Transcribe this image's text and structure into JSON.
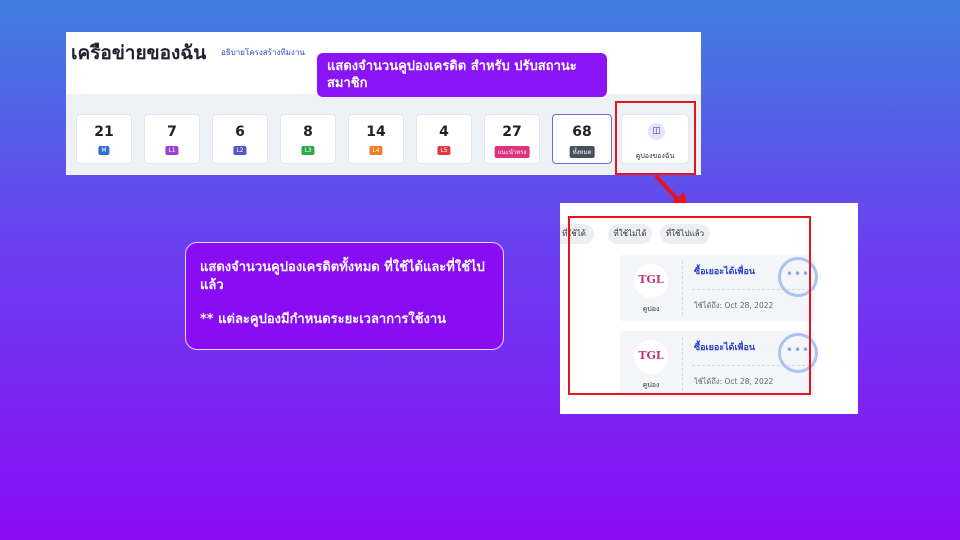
{
  "network": {
    "title": "เครือข่ายของฉัน",
    "subtitle": "อธิบายโครงสร้างทีมงาน",
    "cards": [
      {
        "count": "21",
        "badge": "M",
        "color": "#2d6fd6"
      },
      {
        "count": "7",
        "badge": "L1",
        "color": "#9b3fd6"
      },
      {
        "count": "6",
        "badge": "L2",
        "color": "#5a52c8"
      },
      {
        "count": "8",
        "badge": "L3",
        "color": "#2aa84a"
      },
      {
        "count": "14",
        "badge": "L4",
        "color": "#f07a26"
      },
      {
        "count": "4",
        "badge": "L5",
        "color": "#e0393f"
      },
      {
        "count": "27",
        "badge": "แนะนำตรง",
        "color": "#e0347a"
      },
      {
        "count": "68",
        "badge": "ทั้งหมด",
        "color": "#4a4f5e"
      }
    ],
    "my_coupons_label": "คูปองของฉัน",
    "my_coupons_icon": "ticket-icon"
  },
  "callouts": {
    "top": "แสดงจำนวนคูปองเครดิต สำหรับ ปรับสถานะสมาชิก",
    "middle_line1": "แสดงจำนวนคูปองเครดิตทั้งหมด ที่ใช้ได้และที่ใช้ไปแล้ว",
    "middle_note": "** แต่ละคูปองมีกำหนดระยะเวลาการใช้งาน"
  },
  "coupons_panel": {
    "tabs": [
      "ที่ใช้ได้",
      "ที่ใช้ไม่ได้",
      "ที่ใช้ไปแล้ว"
    ],
    "items": [
      {
        "logo": "TGL",
        "logo_label": "คูปอง",
        "name": "ซื้อเยอะได้เพื่อน",
        "expiry": "ใช้ได้ถึง: Oct 28, 2022"
      },
      {
        "logo": "TGL",
        "logo_label": "คูปอง",
        "name": "ซื้อเยอะได้เพื่อน",
        "expiry": "ใช้ได้ถึง: Oct 28, 2022"
      }
    ]
  },
  "colors": {
    "highlight": "#e8141d",
    "callout": "#8a14f5"
  }
}
